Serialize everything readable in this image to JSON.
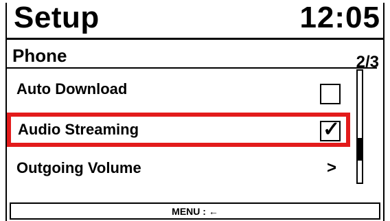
{
  "header": {
    "title": "Setup",
    "clock": "12:05"
  },
  "section": {
    "title": "Phone",
    "page_indicator": "2/3"
  },
  "items": [
    {
      "label": "Auto Download",
      "control": "checkbox",
      "checked": false
    },
    {
      "label": "Audio Streaming",
      "control": "checkbox",
      "checked": true,
      "selected": true,
      "check_glyph": "✓"
    },
    {
      "label": "Outgoing Volume",
      "control": "submenu",
      "glyph": ">"
    }
  ],
  "scrollbar": {
    "position_fraction": 0.75,
    "visible_fraction": 0.2
  },
  "softkey": {
    "label": "MENU : ←"
  },
  "colors": {
    "selection": "#e31b1b",
    "foreground": "#000000",
    "background": "#ffffff"
  }
}
